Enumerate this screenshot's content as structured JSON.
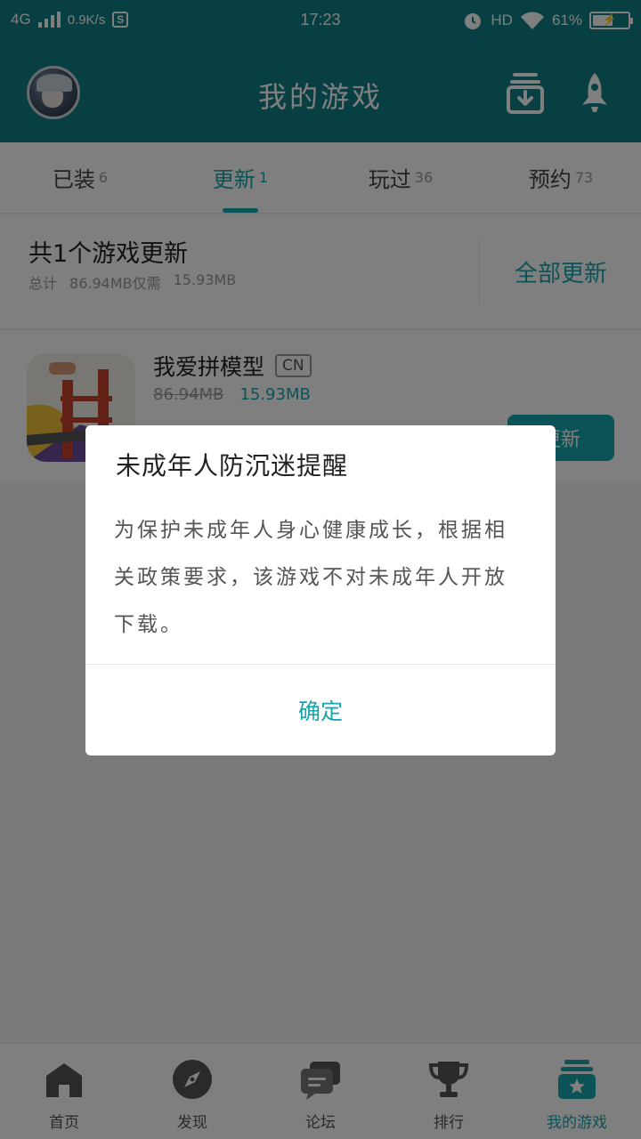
{
  "status_bar": {
    "network": "4G",
    "speed": "0.9K/s",
    "s_badge": "S",
    "time": "17:23",
    "hd": "HD",
    "battery": "61%",
    "battery_level": 0.61
  },
  "header": {
    "title": "我的游戏"
  },
  "tabs": [
    {
      "label": "已装",
      "count": "6"
    },
    {
      "label": "更新",
      "count": "1"
    },
    {
      "label": "玩过",
      "count": "36"
    },
    {
      "label": "预约",
      "count": "73"
    }
  ],
  "summary": {
    "title": "共1个游戏更新",
    "total_label": "总计",
    "total_size": "86.94MB",
    "need_label": "仅需",
    "need_size": "15.93MB",
    "update_all": "全部更新"
  },
  "game": {
    "name": "我爱拼模型",
    "tag": "CN",
    "old_size": "86.94MB",
    "new_size": "15.93MB",
    "button": "更新"
  },
  "bottom_nav": [
    {
      "label": "首页",
      "icon": "home-icon"
    },
    {
      "label": "发现",
      "icon": "compass-icon"
    },
    {
      "label": "论坛",
      "icon": "chat-icon"
    },
    {
      "label": "排行",
      "icon": "trophy-icon"
    },
    {
      "label": "我的游戏",
      "icon": "my-games-icon"
    }
  ],
  "dialog": {
    "title": "未成年人防沉迷提醒",
    "message": "为保护未成年人身心健康成长，根据相关政策要求，该游戏不对未成年人开放下载。",
    "confirm": "确定"
  },
  "colors": {
    "brand": "#0f7f86",
    "accent": "#16a6ad"
  }
}
